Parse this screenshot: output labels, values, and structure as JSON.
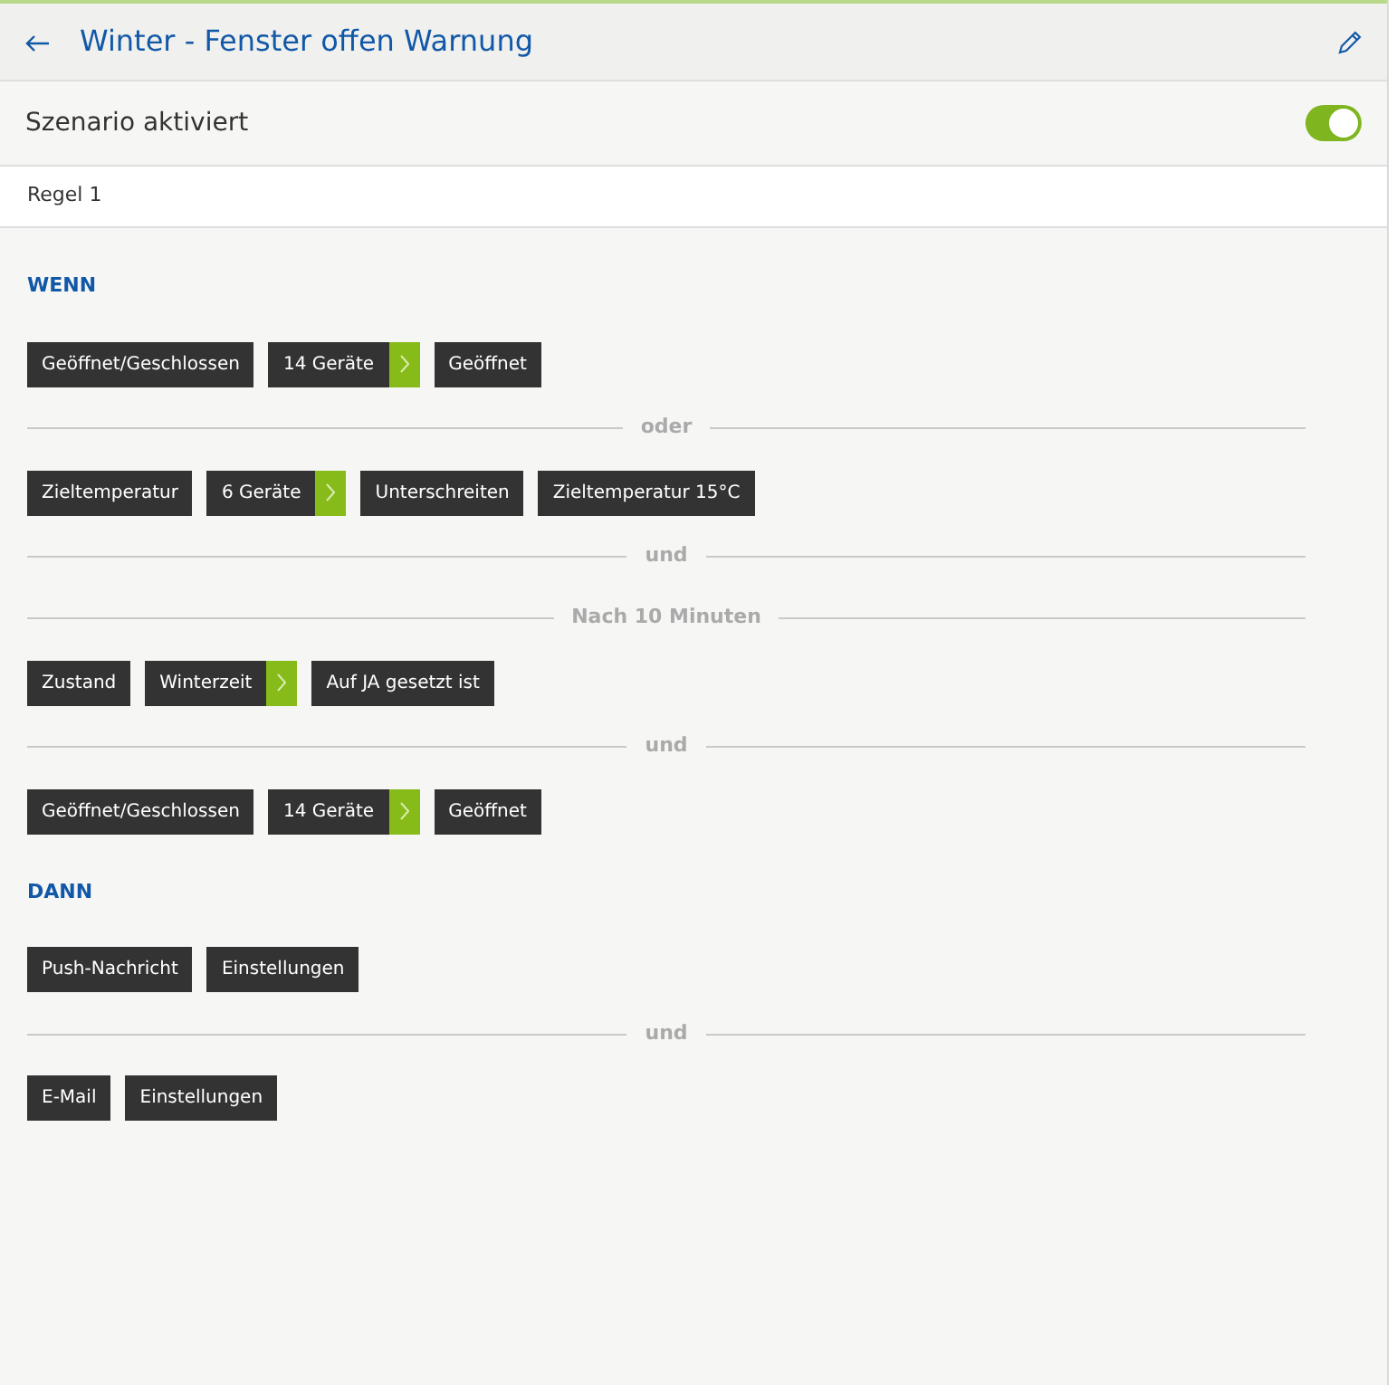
{
  "header": {
    "title": "Winter - Fenster offen Warnung"
  },
  "scenario": {
    "label": "Szenario aktiviert",
    "on": true
  },
  "rule": {
    "label": "Regel 1"
  },
  "sections": [
    {
      "title": "WENN",
      "items": [
        {
          "kind": "chips",
          "chips": [
            {
              "kind": "plain",
              "label": "Geöffnet/Geschlossen"
            },
            {
              "kind": "devices",
              "label": "14 Geräte"
            },
            {
              "kind": "plain",
              "label": "Geöffnet"
            }
          ]
        },
        {
          "kind": "separator",
          "label": "oder"
        },
        {
          "kind": "chips",
          "chips": [
            {
              "kind": "plain",
              "label": "Zieltemperatur"
            },
            {
              "kind": "devices",
              "label": "6 Geräte"
            },
            {
              "kind": "plain",
              "label": "Unterschreiten"
            },
            {
              "kind": "plain",
              "label": "Zieltemperatur 15°C"
            }
          ]
        },
        {
          "kind": "separator",
          "label": "und"
        },
        {
          "kind": "separator",
          "label": "Nach 10 Minuten"
        },
        {
          "kind": "chips",
          "chips": [
            {
              "kind": "plain",
              "label": "Zustand"
            },
            {
              "kind": "devices",
              "label": "Winterzeit"
            },
            {
              "kind": "plain",
              "label": "Auf JA gesetzt ist"
            }
          ]
        },
        {
          "kind": "separator",
          "label": "und"
        },
        {
          "kind": "chips",
          "chips": [
            {
              "kind": "plain",
              "label": "Geöffnet/Geschlossen"
            },
            {
              "kind": "devices",
              "label": "14 Geräte"
            },
            {
              "kind": "plain",
              "label": "Geöffnet"
            }
          ]
        }
      ]
    },
    {
      "title": "DANN",
      "items": [
        {
          "kind": "chips",
          "chips": [
            {
              "kind": "plain",
              "label": "Push-Nachricht"
            },
            {
              "kind": "plain",
              "label": "Einstellungen"
            }
          ]
        },
        {
          "kind": "separator",
          "label": "und"
        },
        {
          "kind": "chips",
          "chips": [
            {
              "kind": "plain",
              "label": "E-Mail"
            },
            {
              "kind": "plain",
              "label": "Einstellungen"
            }
          ]
        }
      ]
    }
  ]
}
